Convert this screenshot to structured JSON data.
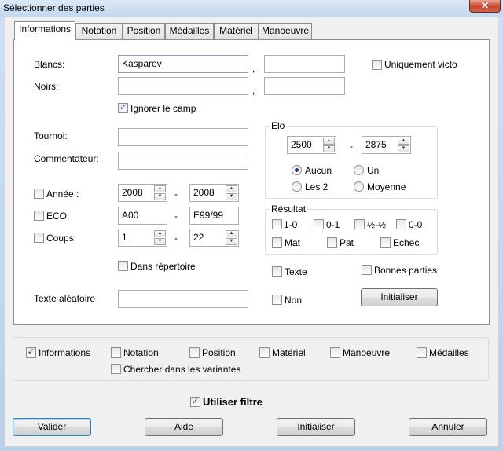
{
  "window": {
    "title": "Sélectionner des parties",
    "close_symbol": "✕"
  },
  "tabs": [
    "Informations",
    "Notation",
    "Position",
    "Médailles",
    "Matériel",
    "Manoeuvre"
  ],
  "info": {
    "blancs_label": "Blancs:",
    "blancs_value": "Kasparov",
    "blancs_value2": "",
    "noirs_label": "Noirs:",
    "noirs_value": "",
    "noirs_value2": "",
    "separator": ",",
    "uniquement_label": "Uniquement victo",
    "ignorer_label": "Ignorer le camp",
    "tournoi_label": "Tournoi:",
    "tournoi_value": "",
    "commentateur_label": "Commentateur:",
    "commentateur_value": "",
    "annee_label": "Année :",
    "annee_from": "2008",
    "annee_to": "2008",
    "eco_label": "ECO:",
    "eco_from": "A00",
    "eco_to": "E99/99",
    "coups_label": "Coups:",
    "coups_from": "1",
    "coups_to": "22",
    "range_dash": "-",
    "dans_repertoire_label": "Dans répertoire",
    "texte_aleatoire_label": "Texte aléatoire",
    "texte_aleatoire_value": ""
  },
  "elo": {
    "title": "Elo",
    "from": "2500",
    "to": "2875",
    "dash": "-",
    "options": [
      "Aucun",
      "Un",
      "Les 2",
      "Moyenne"
    ],
    "selected": "Aucun"
  },
  "resultat": {
    "title": "Résultat",
    "options": [
      "1-0",
      "0-1",
      "½-½",
      "0-0",
      "Mat",
      "Pat",
      "Echec"
    ]
  },
  "extras": {
    "texte_label": "Texte",
    "non_label": "Non",
    "bonnes_parties_label": "Bonnes parties",
    "initialiser_label": "Initialiser"
  },
  "filters": {
    "items": [
      "Informations",
      "Notation",
      "Position",
      "Matériel",
      "Manoeuvre",
      "Médailles"
    ],
    "checked": [
      "Informations"
    ],
    "variantes_label": "Chercher dans les variantes"
  },
  "utiliser_filtre_label": "Utiliser filtre",
  "check_mark": "✓",
  "spin_up": "▲",
  "spin_down": "▼",
  "buttons": {
    "valider": "Valider",
    "aide": "Aide",
    "initialiser": "Initialiser",
    "annuler": "Annuler"
  }
}
